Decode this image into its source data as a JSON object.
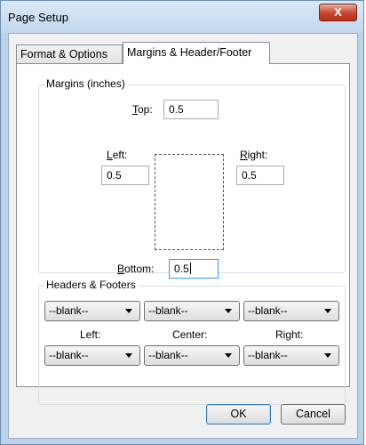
{
  "window": {
    "title": "Page Setup",
    "close_label": "X"
  },
  "tabs": [
    {
      "label": "Format & Options",
      "active": false
    },
    {
      "label": "Margins & Header/Footer",
      "active": true
    }
  ],
  "margins": {
    "group_label": "Margins (inches)",
    "top": {
      "key": "T",
      "rest": "op:",
      "value": "0.5"
    },
    "left": {
      "key": "L",
      "rest": "eft:",
      "value": "0.5"
    },
    "right": {
      "key": "R",
      "rest": "ight:",
      "value": "0.5"
    },
    "bottom": {
      "key": "B",
      "rest": "ottom:",
      "value": "0.5"
    }
  },
  "headers_footers": {
    "group_label": "Headers & Footers",
    "header_left": "--blank--",
    "header_center": "--blank--",
    "header_right": "--blank--",
    "footer_left": "--blank--",
    "footer_center": "--blank--",
    "footer_right": "--blank--",
    "col_left": "Left:",
    "col_center": "Center:",
    "col_right": "Right:"
  },
  "buttons": {
    "ok": "OK",
    "cancel": "Cancel"
  }
}
